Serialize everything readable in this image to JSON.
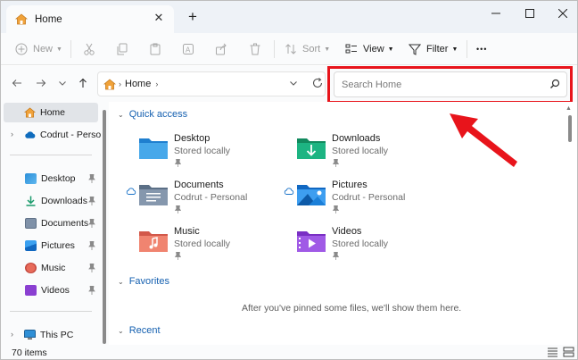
{
  "window": {
    "tab_title": "Home",
    "new_tab": "+",
    "close_tab": "✕"
  },
  "toolbar": {
    "new_label": "New",
    "sort_label": "Sort",
    "view_label": "View",
    "filter_label": "Filter",
    "more_label": "•••"
  },
  "address": {
    "crumb": "Home"
  },
  "search": {
    "placeholder": "Search Home"
  },
  "sidebar": {
    "home": "Home",
    "onedrive": "Codrut - Persona",
    "pinned": [
      {
        "label": "Desktop"
      },
      {
        "label": "Downloads"
      },
      {
        "label": "Documents"
      },
      {
        "label": "Pictures"
      },
      {
        "label": "Music"
      },
      {
        "label": "Videos"
      }
    ],
    "this_pc": "This PC"
  },
  "main": {
    "quick_access": "Quick access",
    "items": [
      {
        "name": "Desktop",
        "sub": "Stored locally"
      },
      {
        "name": "Downloads",
        "sub": "Stored locally"
      },
      {
        "name": "Documents",
        "sub": "Codrut - Personal"
      },
      {
        "name": "Pictures",
        "sub": "Codrut - Personal"
      },
      {
        "name": "Music",
        "sub": "Stored locally"
      },
      {
        "name": "Videos",
        "sub": "Stored locally"
      }
    ],
    "favorites": "Favorites",
    "favorites_empty": "After you've pinned some files, we'll show them here.",
    "recent": "Recent"
  },
  "status": {
    "item_count": "70 items"
  },
  "colors": {
    "accent": "#1560b0",
    "highlight_red": "#e8141b"
  }
}
